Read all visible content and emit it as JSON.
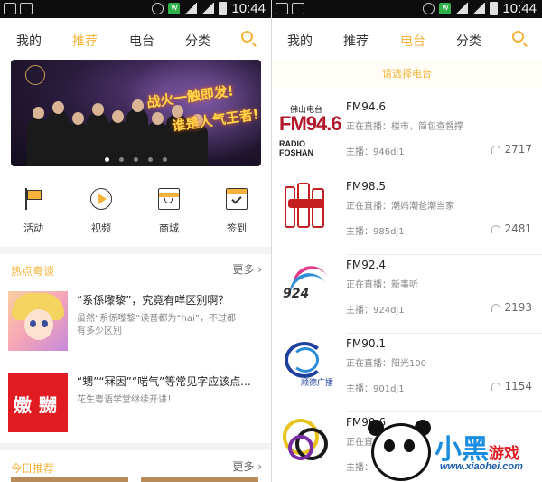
{
  "status_bar": {
    "time": "10:44"
  },
  "left": {
    "tabs": [
      {
        "label": "我的",
        "active": false
      },
      {
        "label": "推荐",
        "active": true
      },
      {
        "label": "电台",
        "active": false
      },
      {
        "label": "分类",
        "active": false
      }
    ],
    "search_icon": "search-icon",
    "banner": {
      "slogan_line1": "战火一触即发!",
      "slogan_line2": "谁是人气王者!",
      "page_count": 5,
      "active_page": 1
    },
    "quick_actions": [
      {
        "label": "活动",
        "icon": "flag-icon"
      },
      {
        "label": "视频",
        "icon": "play-icon"
      },
      {
        "label": "商城",
        "icon": "shop-bag-icon"
      },
      {
        "label": "签到",
        "icon": "checkin-icon"
      }
    ],
    "hot_topics": {
      "title": "热点粤谈",
      "more": "更多",
      "items": [
        {
          "title": "“系係嚟黎”，究竟有咩区别啊？",
          "desc": "虽然“系係嚟黎”读音都为“hai”，不过都有多少区别"
        },
        {
          "title": "“甥”“冧因”“啱气”等常见字应该点...",
          "desc": "花生粤语学堂继续开讲！"
        }
      ]
    },
    "today_recommend": {
      "title": "今日推荐",
      "more": "更多"
    }
  },
  "right": {
    "tabs": [
      {
        "label": "我的",
        "active": false
      },
      {
        "label": "推荐",
        "active": false
      },
      {
        "label": "电台",
        "active": true
      },
      {
        "label": "分类",
        "active": false
      }
    ],
    "choose_label": "请选择电台",
    "stations": [
      {
        "name": "FM94.6",
        "live": "正在直播：楼市，简包查督撑",
        "host": "主播：946dj1",
        "listeners": "2717",
        "logo_small": "佛山电台",
        "logo_big": "FM94.6",
        "logo_sub": "RADIO FOSHAN"
      },
      {
        "name": "FM98.5",
        "live": "正在直播：潮妈潮爸潮当家",
        "host": "主播：985dj1",
        "listeners": "2481"
      },
      {
        "name": "FM92.4",
        "live": "正在直播：新事听",
        "host": "主播：924dj1",
        "listeners": "2193",
        "logo_num": "924"
      },
      {
        "name": "FM90.1",
        "live": "正在直播：阳光100",
        "host": "主播：901dj1",
        "listeners": "1154",
        "logo_caption": "顺德广播"
      },
      {
        "name": "FM90.6",
        "live": "正在直播：",
        "host": "主播：",
        "listeners": ""
      }
    ]
  },
  "watermark": {
    "brand": "小黑",
    "brand_game": "游戏",
    "url": "www.xiaohei.com"
  },
  "colors": {
    "accent": "#f6b23a",
    "status_bar": "#0d0d0d",
    "hot_red": "#e11b22"
  }
}
